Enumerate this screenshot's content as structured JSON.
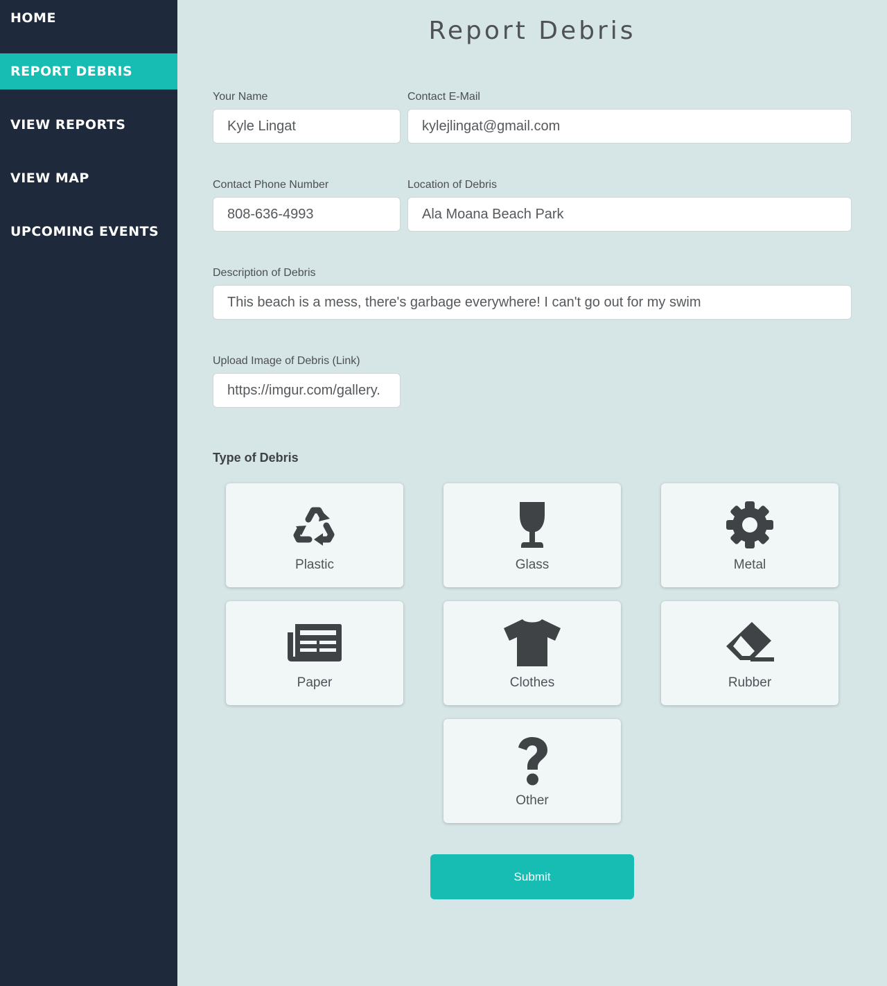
{
  "nav": {
    "items": [
      {
        "label": "HOME"
      },
      {
        "label": "REPORT DEBRIS"
      },
      {
        "label": "VIEW REPORTS"
      },
      {
        "label": "VIEW MAP"
      },
      {
        "label": "UPCOMING EVENTS"
      }
    ],
    "active": "REPORT DEBRIS"
  },
  "page": {
    "title": "Report Debris"
  },
  "form": {
    "name": {
      "label": "Your Name",
      "value": "Kyle Lingat"
    },
    "email": {
      "label": "Contact E-Mail",
      "value": "kylejlingat@gmail.com"
    },
    "phone": {
      "label": "Contact Phone Number",
      "value": "808-636-4993"
    },
    "location": {
      "label": "Location of Debris",
      "value": "Ala Moana Beach Park"
    },
    "description": {
      "label": "Description of Debris",
      "value": "This beach is a mess, there's garbage everywhere! I can't go out for my swim"
    },
    "image": {
      "label": "Upload Image of Debris (Link)",
      "value": "https://imgur.com/gallery."
    },
    "type_label": "Type of Debris",
    "types": [
      {
        "label": "Plastic",
        "icon": "recycle-icon"
      },
      {
        "label": "Glass",
        "icon": "wine-glass-icon"
      },
      {
        "label": "Metal",
        "icon": "gear-icon"
      },
      {
        "label": "Paper",
        "icon": "newspaper-icon"
      },
      {
        "label": "Clothes",
        "icon": "tshirt-icon"
      },
      {
        "label": "Rubber",
        "icon": "eraser-icon"
      },
      {
        "label": "Other",
        "icon": "question-icon"
      }
    ],
    "submit_label": "Submit"
  },
  "colors": {
    "sidebar": "#1e2a3b",
    "accent": "#17bcb3",
    "background": "#d6e5e6",
    "card": "#f1f7f7",
    "icon": "#3f4346"
  }
}
